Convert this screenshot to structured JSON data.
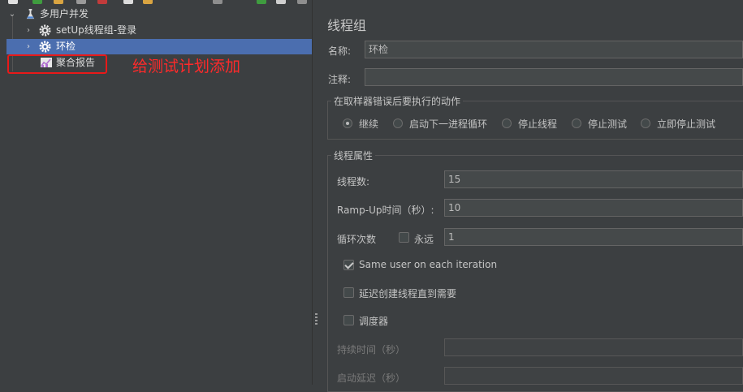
{
  "tree": {
    "root": {
      "label": "多用户并发"
    },
    "items": [
      {
        "label": "setUp线程组-登录"
      },
      {
        "label": "环检"
      },
      {
        "label": "聚合报告"
      }
    ],
    "annotation": "给测试计划添加"
  },
  "panel": {
    "title": "线程组",
    "name_label": "名称:",
    "name_value": "环检",
    "comment_label": "注释:",
    "comment_value": "",
    "error_action": {
      "title": "在取样器错误后要执行的动作",
      "options": [
        "继续",
        "启动下一进程循环",
        "停止线程",
        "停止测试",
        "立即停止测试"
      ],
      "selected": "继续"
    },
    "thread_props": {
      "title": "线程属性",
      "threads_label": "线程数:",
      "threads_value": "15",
      "rampup_label": "Ramp-Up时间（秒）:",
      "rampup_value": "10",
      "loop_label": "循环次数",
      "forever_label": "永远",
      "forever_checked": false,
      "loop_value": "1",
      "same_user_label": "Same user on each iteration",
      "same_user_checked": true,
      "delay_label": "延迟创建线程直到需要",
      "delay_checked": false,
      "scheduler_label": "调度器",
      "scheduler_checked": false,
      "duration_label": "持续时间（秒）",
      "duration_value": "",
      "startup_delay_label": "启动延迟（秒）",
      "startup_delay_value": ""
    }
  },
  "colors": {
    "selection": "#4b6eaf",
    "annotation": "#ff2a2a",
    "background": "#3c3f41"
  }
}
